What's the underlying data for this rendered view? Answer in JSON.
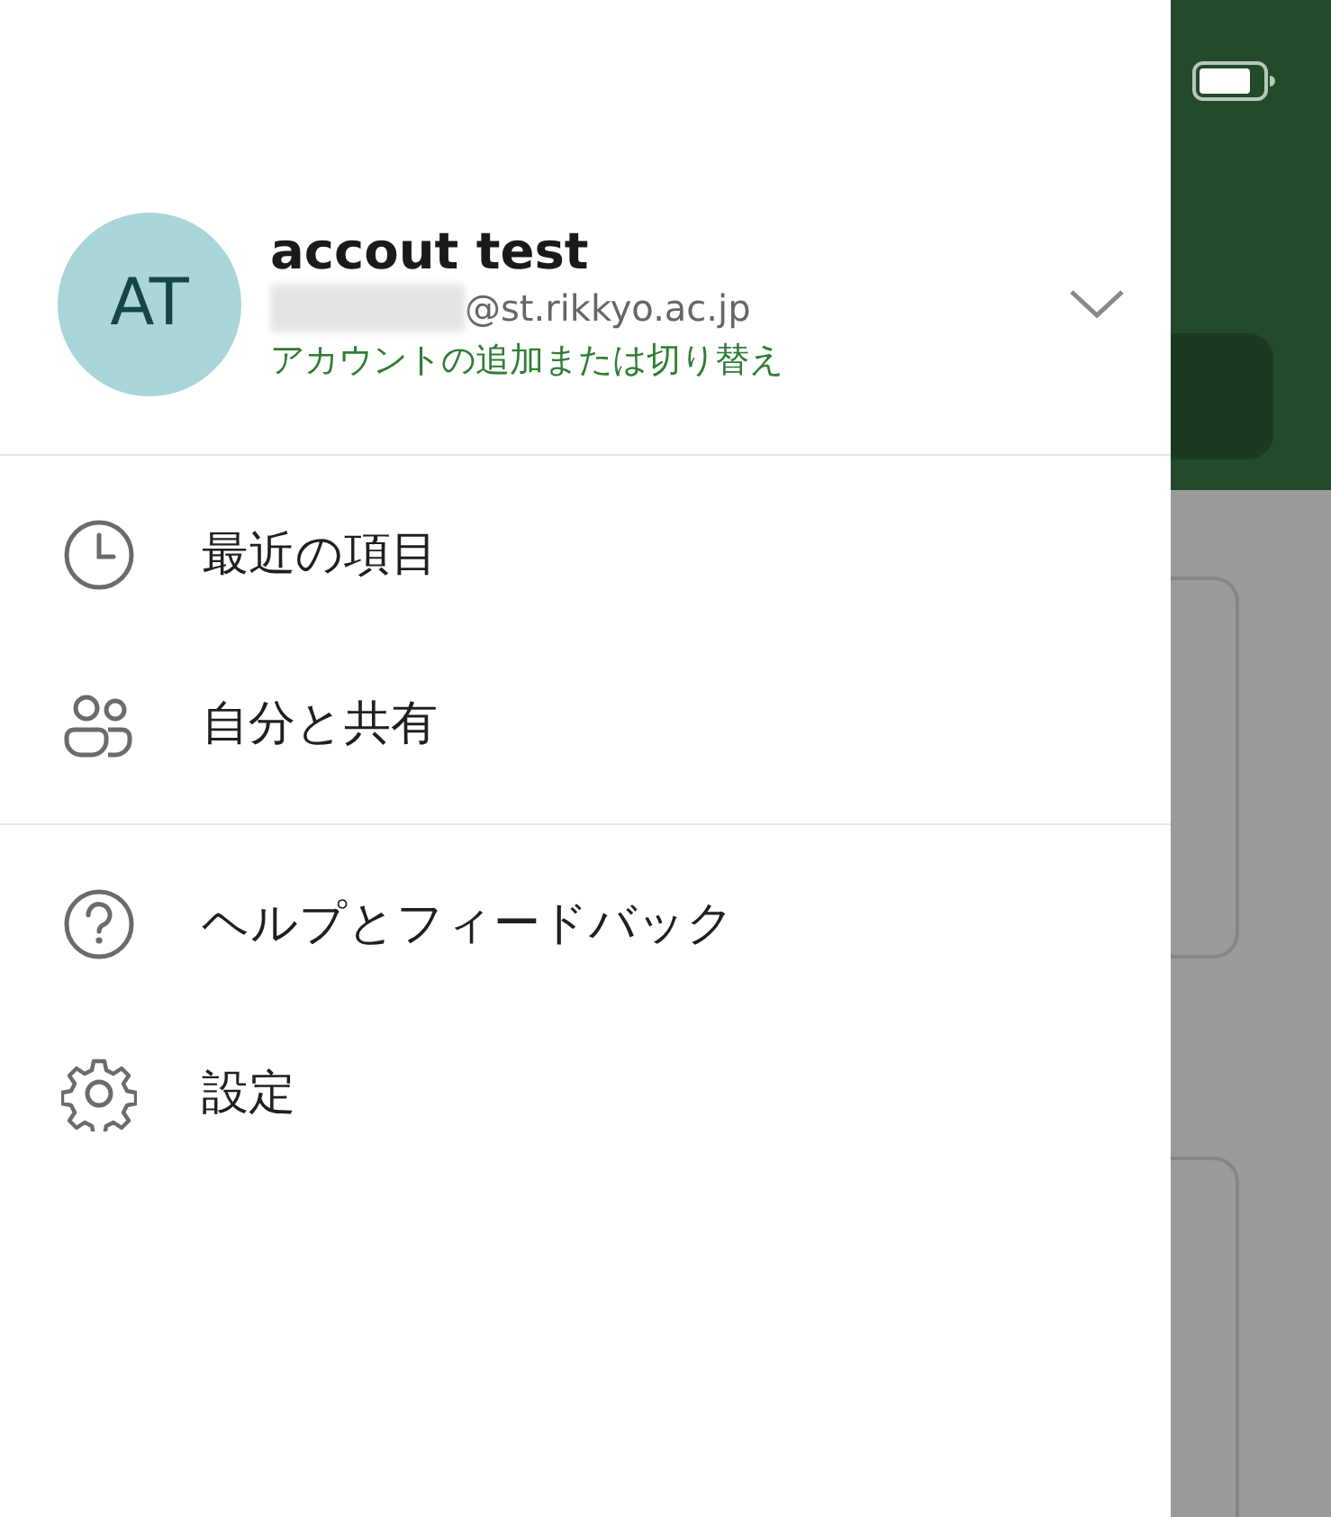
{
  "account": {
    "initials": "AT",
    "name": "accout test",
    "email": "@st.rikkyo.ac.jp",
    "switch_link": "アカウントの追加または切り替え",
    "expanded": false
  },
  "menu_groups": [
    [
      {
        "label": "最近の項目",
        "kind": "recent"
      },
      {
        "label": "自分と共有",
        "kind": "shared"
      }
    ],
    [
      {
        "label": "ヘルプとフィードバック",
        "kind": "help"
      },
      {
        "label": "設定",
        "kind": "settings"
      }
    ]
  ]
}
